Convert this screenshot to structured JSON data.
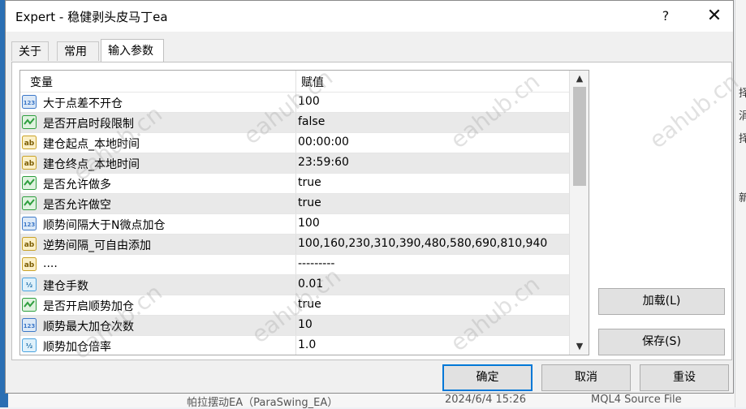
{
  "dialog": {
    "title": "Expert - 稳健剥头皮马丁ea",
    "help_label": "?",
    "close_label": "✕"
  },
  "tabs": [
    {
      "label": "关于",
      "active": false
    },
    {
      "label": "常用",
      "active": false
    },
    {
      "label": "输入参数",
      "active": true
    }
  ],
  "grid": {
    "col_name": "变量",
    "col_value": "赋值",
    "rows": [
      {
        "type": "int",
        "icon": "int-icon",
        "name": "大于点差不开仓",
        "value": "100"
      },
      {
        "type": "bool",
        "icon": "bool-icon",
        "name": "是否开启时段限制",
        "value": "false"
      },
      {
        "type": "string",
        "icon": "string-icon",
        "name": "建仓起点_本地时间",
        "value": "00:00:00"
      },
      {
        "type": "string",
        "icon": "string-icon",
        "name": "建仓终点_本地时间",
        "value": "23:59:60"
      },
      {
        "type": "bool",
        "icon": "bool-icon",
        "name": "是否允许做多",
        "value": "true"
      },
      {
        "type": "bool",
        "icon": "bool-icon",
        "name": "是否允许做空",
        "value": "true"
      },
      {
        "type": "int",
        "icon": "int-icon",
        "name": "顺势间隔大于N微点加仓",
        "value": "100"
      },
      {
        "type": "string",
        "icon": "string-icon",
        "name": "逆势间隔_可自由添加",
        "value": "100,160,230,310,390,480,580,690,810,940"
      },
      {
        "type": "string",
        "icon": "string-icon",
        "name": "....",
        "value": "---------"
      },
      {
        "type": "double",
        "icon": "double-icon",
        "name": "建仓手数",
        "value": "0.01"
      },
      {
        "type": "bool",
        "icon": "bool-icon",
        "name": "是否开启顺势加仓",
        "value": "true"
      },
      {
        "type": "int",
        "icon": "int-icon",
        "name": "顺势最大加仓次数",
        "value": "10"
      },
      {
        "type": "double",
        "icon": "double-icon",
        "name": "顺势加仓倍率",
        "value": "1.0"
      }
    ]
  },
  "buttons": {
    "load": "加载(L)",
    "save": "保存(S)",
    "ok": "确定",
    "cancel": "取消",
    "reset": "重设"
  },
  "watermark": "eahub.cn",
  "background": {
    "right_chars": [
      "择",
      "涓",
      "择",
      "新"
    ],
    "bottom_name": "帕拉摆动EA（ParaSwing_EA）",
    "bottom_date": "2024/6/4 15:26",
    "bottom_type": "MQL4 Source File"
  },
  "colors": {
    "accent": "#0078d7",
    "int_icon": "#3c78c8",
    "bool_icon": "#2e9e3e",
    "string_icon": "#c9a227",
    "double_icon": "#4aa3df"
  }
}
